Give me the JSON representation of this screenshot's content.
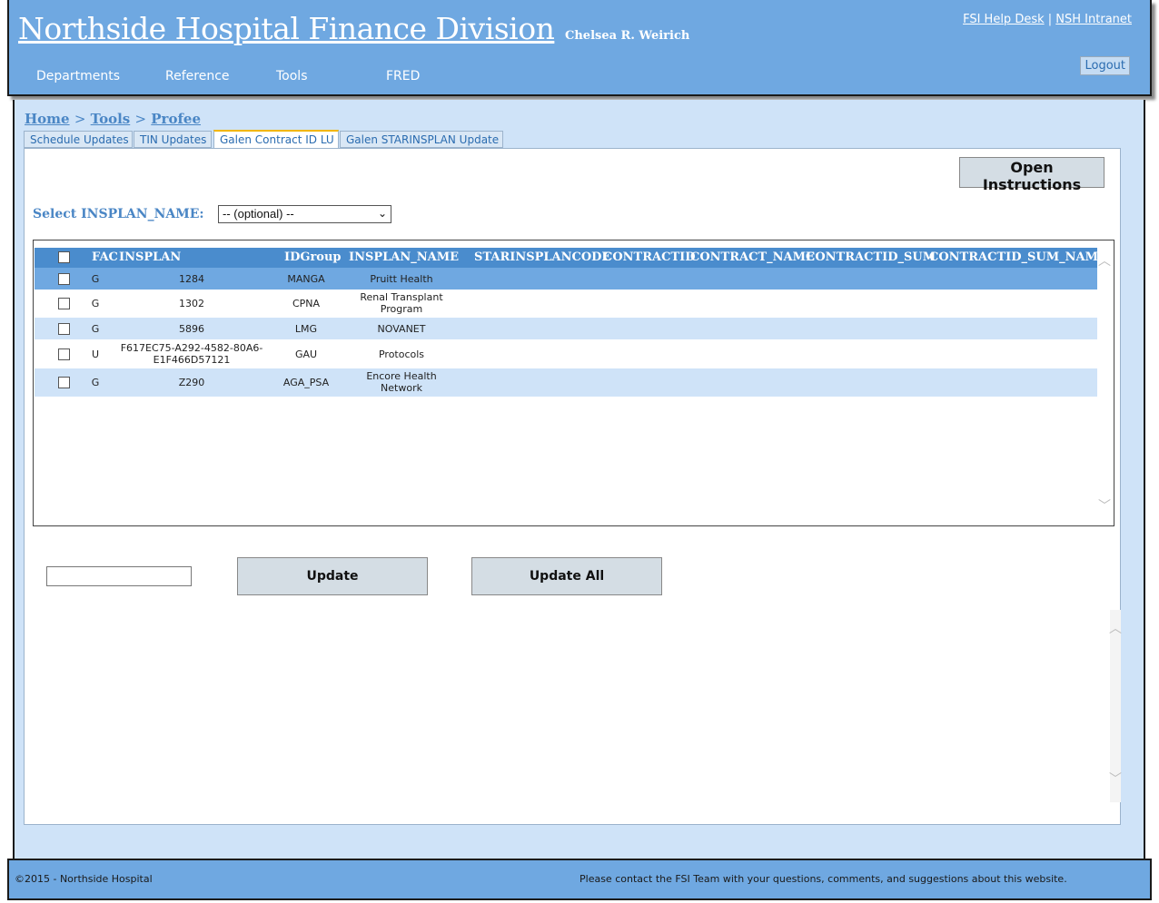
{
  "header": {
    "title": "Northside Hospital Finance Division",
    "user": "Chelsea R. Weirich",
    "links": [
      "FSI Help Desk",
      "NSH Intranet"
    ],
    "link_sep": "|",
    "logout": "Logout",
    "nav": [
      "Departments",
      "Reference",
      "Tools",
      "FRED"
    ]
  },
  "breadcrumb": {
    "items": [
      "Home",
      "Tools",
      "Profee"
    ],
    "sep": ">"
  },
  "tabs": [
    "Schedule Updates",
    "TIN Updates",
    "Galen Contract ID LU",
    "Galen STARINSPLAN Update"
  ],
  "active_tab": 2,
  "instructions_button": "Open Instructions",
  "select": {
    "label": "Select INSPLAN_NAME:",
    "value": "-- (optional) --",
    "chevron": "⌄"
  },
  "grid": {
    "columns": [
      "FAC",
      "INSPLAN",
      "IDGroup",
      "INSPLAN_NAME",
      "STARINSPLANCODE",
      "CONTRACTID",
      "CONTRACT_NAME",
      "CONTRACTID_SUM",
      "CONTRACTID_SUM_NAME"
    ],
    "rows": [
      {
        "fac": "G",
        "insplan": "1284",
        "idgroup": "MANGA",
        "name": "Pruitt Health",
        "selected": true
      },
      {
        "fac": "G",
        "insplan": "1302",
        "idgroup": "CPNA",
        "name": "Renal Transplant Program",
        "selected": false
      },
      {
        "fac": "G",
        "insplan": "5896",
        "idgroup": "LMG",
        "name": "NOVANET",
        "selected": false
      },
      {
        "fac": "U",
        "insplan": "F617EC75-A292-4582-80A6-E1F466D57121",
        "idgroup": "GAU",
        "name": "Protocols",
        "selected": false
      },
      {
        "fac": "G",
        "insplan": "Z290",
        "idgroup": "AGA_PSA",
        "name": "Encore Health Network",
        "selected": false
      }
    ],
    "scroll_up": "︿",
    "scroll_down": "﹀"
  },
  "actions": {
    "update": "Update",
    "update_all": "Update All"
  },
  "footer": {
    "copyright": "©2015 - Northside Hospital",
    "contact": "Please contact the FSI Team with your questions, comments, and suggestions about this website."
  },
  "colors": {
    "header_bg": "#6fa8e1",
    "main_bg": "#cfe3f8",
    "grid_header": "#4a8ccd",
    "selected_row": "#6fa8e1",
    "active_tab_accent": "#f2b600"
  }
}
